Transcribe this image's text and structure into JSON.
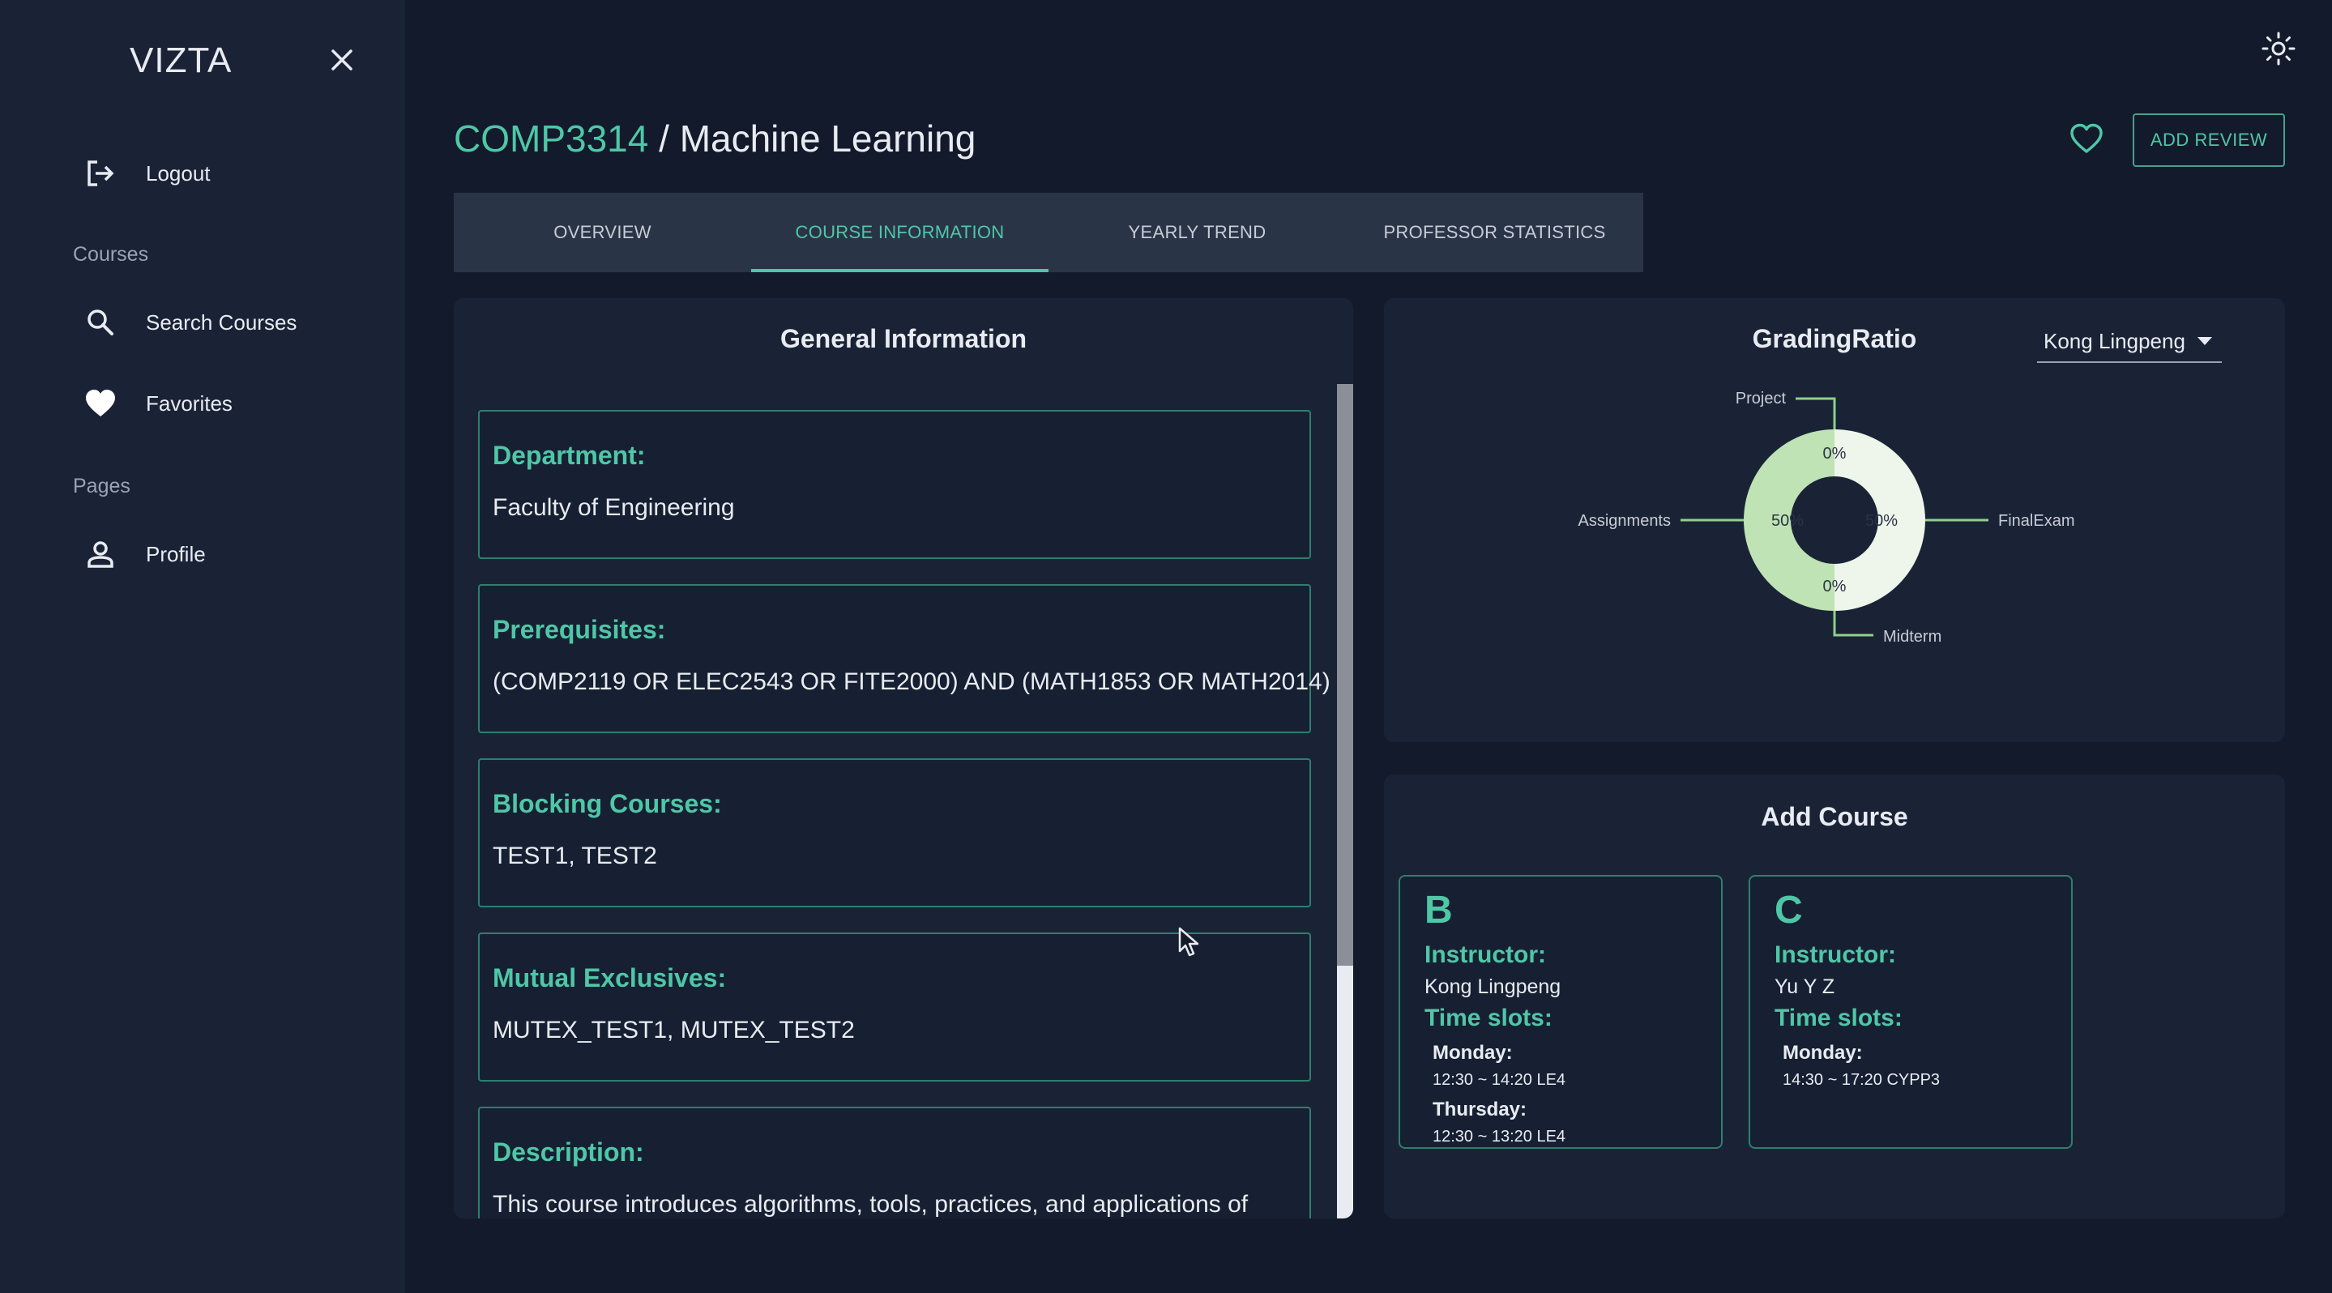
{
  "sidebar": {
    "brand": "VIZTA",
    "logout_label": "Logout",
    "courses_section": "Courses",
    "search_label": "Search Courses",
    "favorites_label": "Favorites",
    "pages_section": "Pages",
    "profile_label": "Profile"
  },
  "header": {
    "course_code": "COMP3314",
    "separator": " / ",
    "course_name": "Machine Learning",
    "review_button": "ADD REVIEW"
  },
  "tabs": [
    {
      "label": "OVERVIEW",
      "active": false
    },
    {
      "label": "COURSE INFORMATION",
      "active": true
    },
    {
      "label": "YEARLY TREND",
      "active": false
    },
    {
      "label": "PROFESSOR STATISTICS",
      "active": false
    }
  ],
  "general": {
    "title": "General Information",
    "cards": [
      {
        "label": "Department:",
        "value": "Faculty of Engineering"
      },
      {
        "label": "Prerequisites:",
        "value": "(COMP2119 OR ELEC2543 OR FITE2000) AND (MATH1853 OR MATH2014)"
      },
      {
        "label": "Blocking Courses:",
        "value": "TEST1, TEST2"
      },
      {
        "label": "Mutual Exclusives:",
        "value": "MUTEX_TEST1, MUTEX_TEST2"
      },
      {
        "label": "Description:",
        "value": "This course introduces algorithms, tools, practices, and applications of"
      }
    ]
  },
  "grading": {
    "title": "GradingRatio",
    "professor_selected": "Kong Lingpeng"
  },
  "chart_data": {
    "type": "pie",
    "title": "GradingRatio",
    "categories": [
      "Project",
      "FinalExam",
      "Midterm",
      "Assignments"
    ],
    "values": [
      0,
      50,
      0,
      50
    ],
    "value_labels": [
      "0%",
      "50%",
      "0%",
      "50%"
    ],
    "colors": [
      "#bfe3b4",
      "#eef5ea",
      "#eef5ea",
      "#bfe3b4"
    ],
    "donut": true,
    "legend": "none"
  },
  "add_course": {
    "title": "Add Course",
    "instructor_label": "Instructor:",
    "timeslots_label": "Time slots:",
    "sections": [
      {
        "letter": "B",
        "instructor": "Kong Lingpeng",
        "slots": [
          {
            "day": "Monday:",
            "time": "12:30 ~ 14:20 LE4"
          },
          {
            "day": "Thursday:",
            "time": "12:30 ~ 13:20 LE4"
          }
        ]
      },
      {
        "letter": "C",
        "instructor": "Yu Y Z",
        "slots": [
          {
            "day": "Monday:",
            "time": "14:30 ~ 17:20 CYPP3"
          }
        ]
      }
    ]
  },
  "icons": {
    "close": "close-icon",
    "logout": "logout-icon",
    "search": "search-icon",
    "favorites": "heart-icon",
    "profile": "person-icon",
    "theme": "sun-icon",
    "favorite_course": "heart-outline-icon"
  },
  "colors": {
    "accent": "#4fc7a7",
    "background": "#131a2b",
    "sidebar": "#1a2336",
    "tabbar": "#2a3447"
  }
}
